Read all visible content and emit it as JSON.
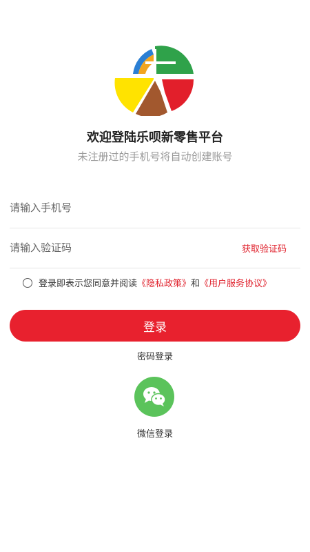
{
  "welcome_title": "欢迎登陆乐呗新零售平台",
  "subtitle": "未注册过的手机号将自动创建账号",
  "phone_input": {
    "placeholder": "请输入手机号",
    "value": ""
  },
  "code_input": {
    "placeholder": "请输入验证码",
    "value": ""
  },
  "get_code_label": "获取验证码",
  "agreement": {
    "prefix": "登录即表示您同意并阅读",
    "privacy_link": "《隐私政策》",
    "and": "和",
    "terms_link": "《用户服务协议》"
  },
  "login_button": "登录",
  "password_login": "密码登录",
  "wechat_login": "微信登录",
  "colors": {
    "accent": "#e8212e",
    "wechat": "#5bc35b"
  },
  "icons": {
    "logo": "lebei-logo",
    "wechat": "wechat-icon",
    "radio": "radio-unchecked-icon"
  }
}
